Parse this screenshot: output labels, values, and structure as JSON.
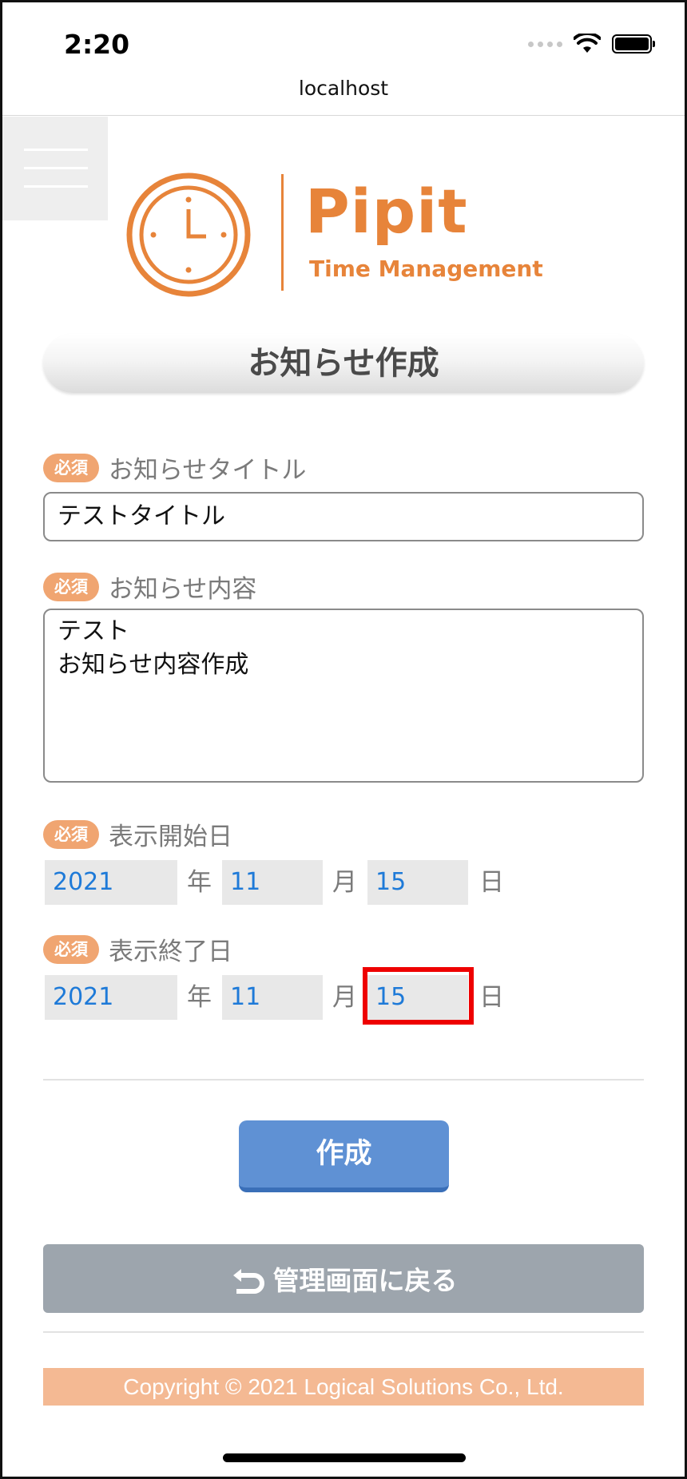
{
  "status_bar": {
    "time": "2:20"
  },
  "browser": {
    "url": "localhost"
  },
  "logo": {
    "name": "Pipit",
    "tagline": "Time Management"
  },
  "page": {
    "title": "お知らせ作成"
  },
  "required_badge": "必須",
  "form": {
    "title_field": {
      "label": "お知らせタイトル",
      "value": "テストタイトル"
    },
    "content_field": {
      "label": "お知らせ内容",
      "value": "テスト\nお知らせ内容作成"
    },
    "start_date": {
      "label": "表示開始日",
      "year": "2021",
      "month": "11",
      "day": "15"
    },
    "end_date": {
      "label": "表示終了日",
      "year": "2021",
      "month": "11",
      "day": "15"
    },
    "units": {
      "year": "年",
      "month": "月",
      "day": "日"
    }
  },
  "buttons": {
    "create": "作成",
    "back": "管理画面に戻る"
  },
  "footer": {
    "copyright": "Copyright © 2021 Logical Solutions Co., Ltd."
  },
  "colors": {
    "accent": "#e7843a",
    "badge": "#f0a571",
    "primary_button": "#5f91d4",
    "secondary_button": "#9da5ad",
    "footer": "#f4b993",
    "date_value": "#1e7ad8",
    "highlight": "#ee0000"
  }
}
